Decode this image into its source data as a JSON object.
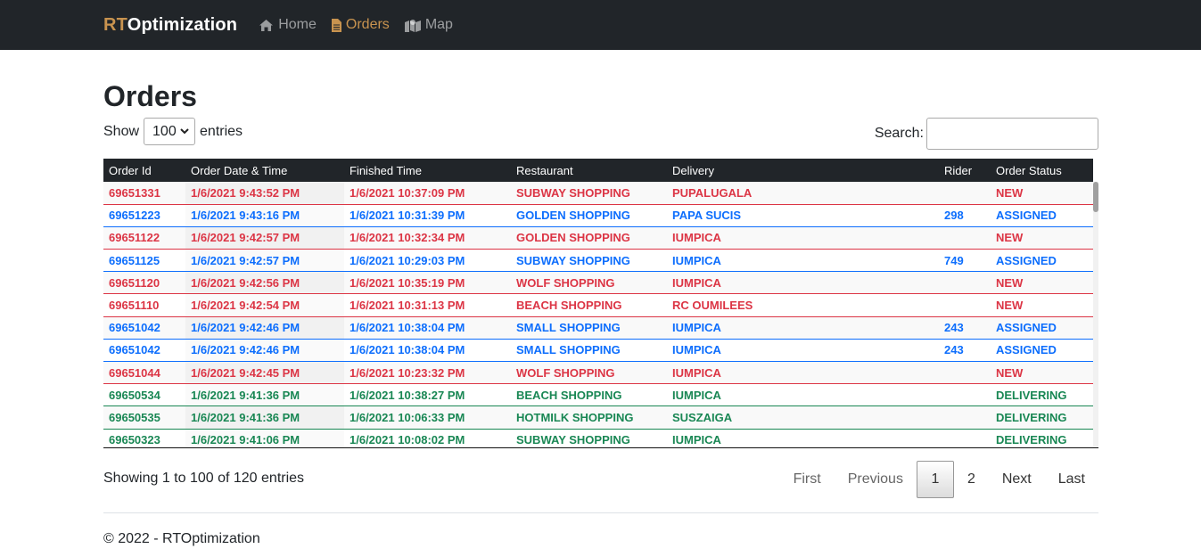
{
  "navbar": {
    "brand_accent": "RT",
    "brand_rest": "Optimization",
    "links": [
      {
        "label": "Home",
        "icon": "home-icon"
      },
      {
        "label": "Orders",
        "icon": "file-icon"
      },
      {
        "label": "Map",
        "icon": "map-icon"
      }
    ],
    "colors": {
      "background": "#212529",
      "accent": "#c8934f"
    }
  },
  "page": {
    "title": "Orders",
    "length": {
      "prefix": "Show",
      "value": "100",
      "suffix": "entries"
    },
    "search": {
      "label": "Search:",
      "value": ""
    },
    "info": "Showing 1 to 100 of 120 entries",
    "footer": "© 2022 - RTOptimization"
  },
  "table": {
    "headers": [
      "Order Id",
      "Order Date & Time",
      "Finished Time",
      "Restaurant",
      "Delivery",
      "Rider",
      "Order Status"
    ],
    "status_colors": {
      "NEW": "#dc3545",
      "ASSIGNED": "#0d6efd",
      "DELIVERING": "#198754"
    },
    "rows": [
      [
        "69651331",
        "1/6/2021 9:43:52 PM",
        "1/6/2021 10:37:09 PM",
        "SUBWAY SHOPPING",
        "PUPALUGALA",
        "",
        "NEW"
      ],
      [
        "69651223",
        "1/6/2021 9:43:16 PM",
        "1/6/2021 10:31:39 PM",
        "GOLDEN SHOPPING",
        "PAPA SUCIS",
        "298",
        "ASSIGNED"
      ],
      [
        "69651122",
        "1/6/2021 9:42:57 PM",
        "1/6/2021 10:32:34 PM",
        "GOLDEN SHOPPING",
        "IUMPICA",
        "",
        "NEW"
      ],
      [
        "69651125",
        "1/6/2021 9:42:57 PM",
        "1/6/2021 10:29:03 PM",
        "SUBWAY SHOPPING",
        "IUMPICA",
        "749",
        "ASSIGNED"
      ],
      [
        "69651120",
        "1/6/2021 9:42:56 PM",
        "1/6/2021 10:35:19 PM",
        "WOLF SHOPPING",
        "IUMPICA",
        "",
        "NEW"
      ],
      [
        "69651110",
        "1/6/2021 9:42:54 PM",
        "1/6/2021 10:31:13 PM",
        "BEACH SHOPPING",
        "RC OUMILEES",
        "",
        "NEW"
      ],
      [
        "69651042",
        "1/6/2021 9:42:46 PM",
        "1/6/2021 10:38:04 PM",
        "SMALL SHOPPING",
        "IUMPICA",
        "243",
        "ASSIGNED"
      ],
      [
        "69651042",
        "1/6/2021 9:42:46 PM",
        "1/6/2021 10:38:04 PM",
        "SMALL SHOPPING",
        "IUMPICA",
        "243",
        "ASSIGNED"
      ],
      [
        "69651044",
        "1/6/2021 9:42:45 PM",
        "1/6/2021 10:23:32 PM",
        "WOLF SHOPPING",
        "IUMPICA",
        "",
        "NEW"
      ],
      [
        "69650534",
        "1/6/2021 9:41:36 PM",
        "1/6/2021 10:38:27 PM",
        "BEACH SHOPPING",
        "IUMPICA",
        "",
        "DELIVERING"
      ],
      [
        "69650535",
        "1/6/2021 9:41:36 PM",
        "1/6/2021 10:06:33 PM",
        "HOTMILK SHOPPING",
        "SUSZAIGA",
        "",
        "DELIVERING"
      ],
      [
        "69650323",
        "1/6/2021 9:41:06 PM",
        "1/6/2021 10:08:02 PM",
        "SUBWAY SHOPPING",
        "IUMPICA",
        "",
        "DELIVERING"
      ]
    ]
  },
  "pagination": {
    "first": "First",
    "previous": "Previous",
    "pages": [
      "1",
      "2"
    ],
    "current": "1",
    "next": "Next",
    "last": "Last"
  }
}
